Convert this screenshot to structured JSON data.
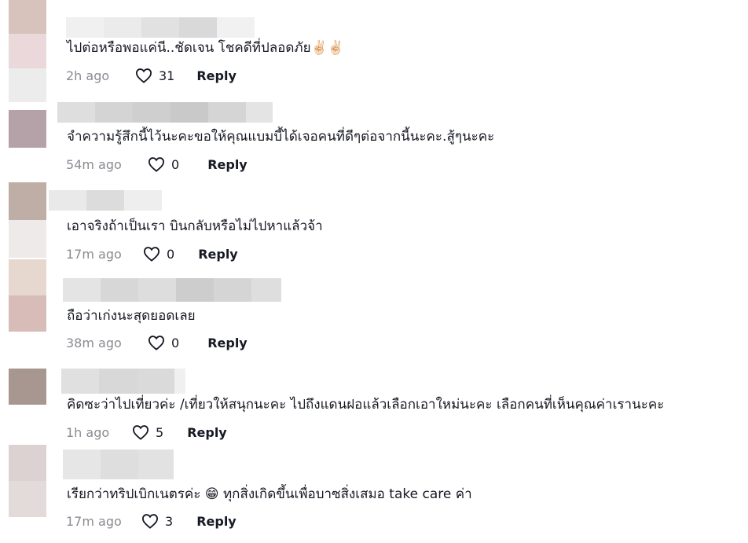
{
  "comments": [
    {
      "text": "ไปต่อหรือพอแค่นี..ชัดเจน โชคดีที่ปลอดภัย✌🏻✌🏻",
      "time": "2h ago",
      "likes": "31",
      "reply_label": "Reply",
      "avatar_colors": [
        "#d7c3bc",
        "#ead8da",
        "#ececec",
        "#f5f2f2"
      ],
      "name_blur_colors": [
        "#eeeeee",
        "#e7e7e7",
        "#dedede",
        "#d6d6d6",
        "#f1f1f1"
      ]
    },
    {
      "text": "จำความรู้สึกนี้ไว้นะคะขอให้คุณแบมบี้ได้เจอคนที่ดีๆต่อจากนี้นะคะ.สู้ๆนะคะ",
      "time": "54m ago",
      "likes": "0",
      "reply_label": "Reply",
      "avatar_colors": [
        "#ffffff",
        "#b4a2a8",
        "#cbbdc1",
        "#ffffff"
      ],
      "name_blur_colors": [
        "#dedede",
        "#d4d4d4",
        "#cfcfcf",
        "#c9c9c9",
        "#d5d5d5",
        "#e4e4e4"
      ]
    },
    {
      "text": "เอาจริงถ้าเป็นเรา บินกลับหรือไม่ไปหาแล้วจ้า",
      "time": "17m ago",
      "likes": "0",
      "reply_label": "Reply",
      "avatar_colors": [
        "#beaea6",
        "#c7b8b1",
        "#eeeaea",
        "#ece7e7"
      ],
      "name_blur_colors": [
        "#e9e9e9",
        "#dcdcdc",
        "#eeeeee"
      ]
    },
    {
      "text": "ถือว่าเก่งนะสุดยอดเลย",
      "time": "38m ago",
      "likes": "0",
      "reply_label": "Reply",
      "avatar_colors": [
        "#e6d7cf",
        "#d8bcb7",
        "#d6bab5",
        "#ffffff"
      ],
      "name_blur_colors": [
        "#e4e4e4",
        "#d7d7d7",
        "#dddddd",
        "#cdcdcd",
        "#d5d5d5",
        "#dedede"
      ]
    },
    {
      "text": "คิดซะว่าไปเที่ยวค่ะ /เที่ยวให้สนุกนะคะ ไปถึงแดนฝอแล้วเลือกเอาใหม่นะคะ เลือกคนที่เห็นคุณค่าเรานะคะ",
      "time": "1h ago",
      "likes": "5",
      "reply_label": "Reply",
      "avatar_colors": [
        "#a89690",
        "#b2a29c",
        "#f5f3f3",
        "#fbfbfb"
      ],
      "name_blur_colors": [
        "#e0e0e0",
        "#d8d8d8",
        "#dadada",
        "#f0f0f0"
      ]
    },
    {
      "text": "เรียกว่าทริปเบิกเนตรค่ะ 😁 ทุกสิ่งเกิดขึ้นเพื่อบาซสิ่งเสมอ take care ค่า",
      "time": "17m ago",
      "likes": "3",
      "reply_label": "Reply",
      "avatar_colors": [
        "#dcd2d2",
        "#ddd3d3",
        "#e7dfdf",
        "#ece7e7"
      ],
      "name_blur_colors": [
        "#e6e6e6",
        "#dedede",
        "#e2e2e2"
      ]
    }
  ]
}
